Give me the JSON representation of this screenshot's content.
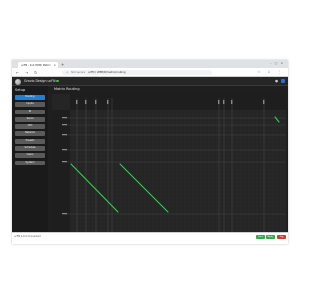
{
  "browser": {
    "tab_title": "ucFN - 4x4 HDMI Matrix",
    "address_security": "Not secure",
    "address_url": "ucFN / WEB/#/matrix/routing"
  },
  "app": {
    "title": "Gravio Design ucFN",
    "status_color": "#3cc03c"
  },
  "sidebar": {
    "title": "Setup",
    "items": [
      {
        "label": "Routing",
        "active": true
      },
      {
        "label": "Inputs",
        "active": false
      },
      {
        "label": "IR",
        "active": false
      },
      {
        "label": "Serial",
        "active": false
      },
      {
        "label": "CEC",
        "active": false
      },
      {
        "label": "Network",
        "active": false
      },
      {
        "label": "Presets",
        "active": false
      },
      {
        "label": "Schedule",
        "active": false
      },
      {
        "label": "Users",
        "active": false
      },
      {
        "label": "System",
        "active": false
      }
    ]
  },
  "main": {
    "title": "Matrix Routing",
    "grid_label": "Destination"
  },
  "footer": {
    "text": "ucFN 1.0.0   Connected",
    "buttons": [
      {
        "label": "Save",
        "color": "#2eaa4a"
      },
      {
        "label": "Apply",
        "color": "#2eaa4a"
      },
      {
        "label": "Log",
        "color": "#d23b3b"
      }
    ]
  },
  "colors": {
    "accent": "#1f7fd6",
    "route_line": "#2fd24a"
  }
}
